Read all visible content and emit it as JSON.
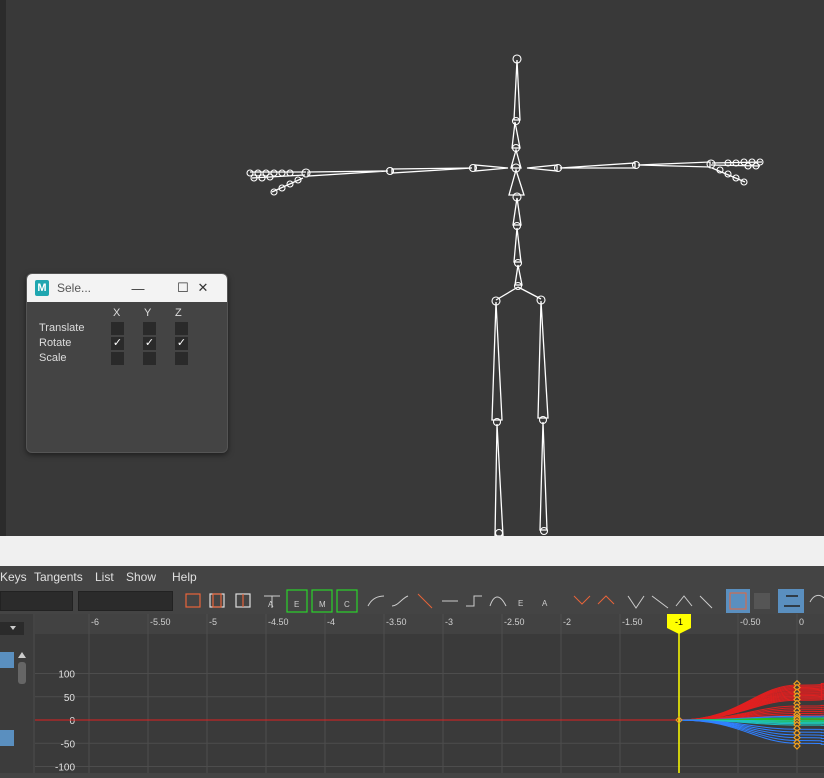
{
  "dialog": {
    "title": "Sele...",
    "columns": [
      "X",
      "Y",
      "Z"
    ],
    "rows": [
      {
        "label": "Translate",
        "x": false,
        "y": false,
        "z": false
      },
      {
        "label": "Rotate",
        "x": true,
        "y": true,
        "z": true
      },
      {
        "label": "Scale",
        "x": false,
        "y": false,
        "z": false
      }
    ],
    "check_glyph": "✓",
    "minimize_glyph": "—",
    "maximize_glyph": "☐",
    "close_glyph": "✕"
  },
  "graph_editor": {
    "menu": [
      "Keys",
      "Tangents",
      "List",
      "Show",
      "Help"
    ],
    "time_ticks": [
      {
        "label": "-6",
        "t": -6
      },
      {
        "label": "-5.50",
        "t": -5.5
      },
      {
        "label": "-5",
        "t": -5
      },
      {
        "label": "-4.50",
        "t": -4.5
      },
      {
        "label": "-4",
        "t": -4
      },
      {
        "label": "-3.50",
        "t": -3.5
      },
      {
        "label": "-3",
        "t": -3
      },
      {
        "label": "-2.50",
        "t": -2.5
      },
      {
        "label": "-2",
        "t": -2
      },
      {
        "label": "-1.50",
        "t": -1.5
      },
      {
        "label": "-0.50",
        "t": -0.5
      },
      {
        "label": "0",
        "t": 0
      }
    ],
    "current_frame": {
      "label": "-1",
      "t": -1
    },
    "value_ticks": [
      {
        "label": "100",
        "v": 100
      },
      {
        "label": "50",
        "v": 50
      },
      {
        "label": "0",
        "v": 0
      },
      {
        "label": "-50",
        "v": -50
      },
      {
        "label": "-100",
        "v": -100
      }
    ],
    "colors": {
      "current_time": "#ffff00",
      "key": "#f0a020",
      "curve_red": "#e02020",
      "curve_green": "#20c020",
      "curve_blue": "#3080ff",
      "curve_cyan": "#20c0c0"
    }
  }
}
